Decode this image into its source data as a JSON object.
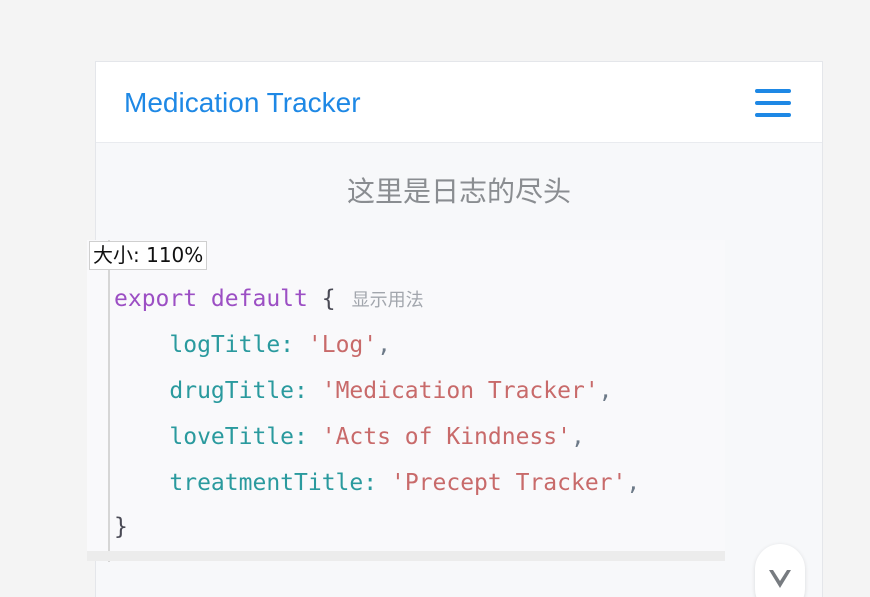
{
  "header": {
    "app_title": "Medication Tracker",
    "menu_icon": "hamburger-menu-icon"
  },
  "main": {
    "end_of_log_text": "这里是日志的尽头"
  },
  "size_badge": {
    "label": "大小: 110%"
  },
  "code": {
    "line1_keyword": "export default",
    "line1_brace": "{",
    "show_usage_hint": "显示用法",
    "entries": [
      {
        "key": "logTitle",
        "value": "'Log'"
      },
      {
        "key": "drugTitle",
        "value": "'Medication Tracker'"
      },
      {
        "key": "loveTitle",
        "value": "'Acts of Kindness'"
      },
      {
        "key": "treatmentTitle",
        "value": "'Precept Tracker'"
      }
    ],
    "closing_brace": "}"
  },
  "scroll_button": {
    "icon": "chevron-down-icon"
  },
  "colors": {
    "accent": "#1e88e5",
    "keyword": "#9c4fc4",
    "key": "#2a9a9e",
    "string": "#c86a6a"
  }
}
